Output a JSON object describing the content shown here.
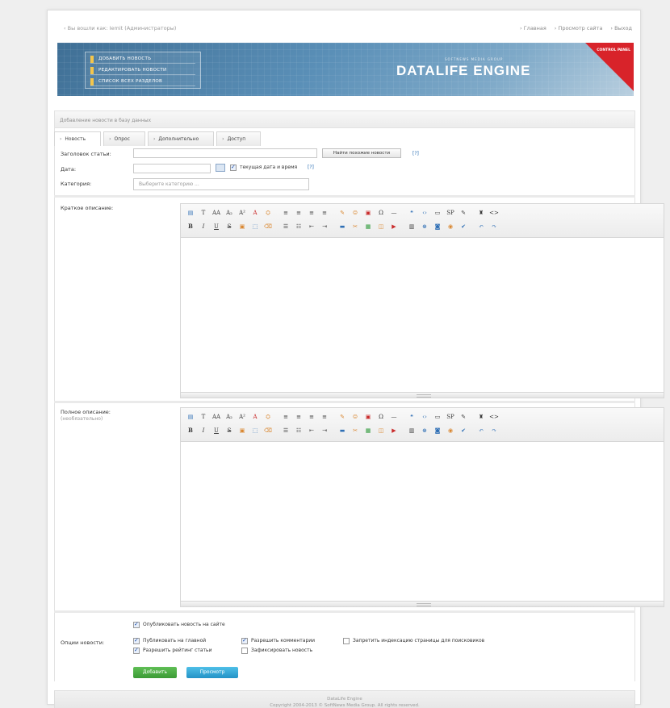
{
  "topbar": {
    "login": "‹ Вы вошли как: Iemit (Администраторы)",
    "links": [
      "› Главная",
      "› Просмотр сайта",
      "› Выход"
    ]
  },
  "banner": {
    "menu_items": [
      "ДОБАВИТЬ НОВОСТЬ",
      "РЕДАКТИРОВАТЬ НОВОСТИ",
      "СПИСОК ВСЕХ РАЗДЕЛОВ"
    ],
    "brand": "DATALIFE ENGINE",
    "brand_sub": "SOFTNEWS MEDIA GROUP",
    "corner": "CONTROL\nPANEL"
  },
  "breadcrumb": "Добавление новости в базу данных",
  "tabs": [
    "Новость",
    "Опрос",
    "Дополнительно",
    "Доступ"
  ],
  "form": {
    "title_label": "Заголовок статьи:",
    "title_value": "",
    "find_similar": "Найти похожие новости",
    "help": "[?]",
    "date_label": "Дата:",
    "date_value": "",
    "current_datetime": "текущая дата и время",
    "category_label": "Категория:",
    "category_placeholder": "Выберите категорию ...",
    "short_label": "Краткое описание:",
    "full_label": "Полное описание:",
    "full_sublabel": "(необязательно)"
  },
  "options": {
    "publish": "Опубликовать новость на сайте",
    "label": "Опции новости:",
    "main": "Публиковать на главной",
    "comments": "Разрешить комментарии",
    "noindex": "Запретить индексацию страницы для поисковиков",
    "rating": "Разрешить рейтинг статьи",
    "fix": "Зафиксировать новость"
  },
  "buttons": {
    "add": "Добавить",
    "preview": "Просмотр"
  },
  "footer": {
    "line1": "DataLife Engine",
    "line2": "Copyright 2004-2013 © SoftNews Media Group. All rights reserved."
  },
  "toolbar": {
    "row1": [
      "▤",
      "T",
      "AA",
      "A₂",
      "A²",
      "A",
      "⛭",
      "≡",
      "≡",
      "≡",
      "≡",
      "✎",
      "☺",
      "▣",
      "Ω",
      "—",
      "❝",
      "‹›",
      "▭",
      "SP",
      "✎",
      "♜",
      "<>"
    ],
    "row2": [
      "B",
      "I",
      "U",
      "S",
      "▣",
      "⬚",
      "⌫",
      "☰",
      "☷",
      "⇤",
      "⇥",
      "▬",
      "✂",
      "▦",
      "◫",
      "▶",
      "▥",
      "⊕",
      "◙",
      "◉",
      "✔",
      "↶",
      "↷"
    ]
  }
}
